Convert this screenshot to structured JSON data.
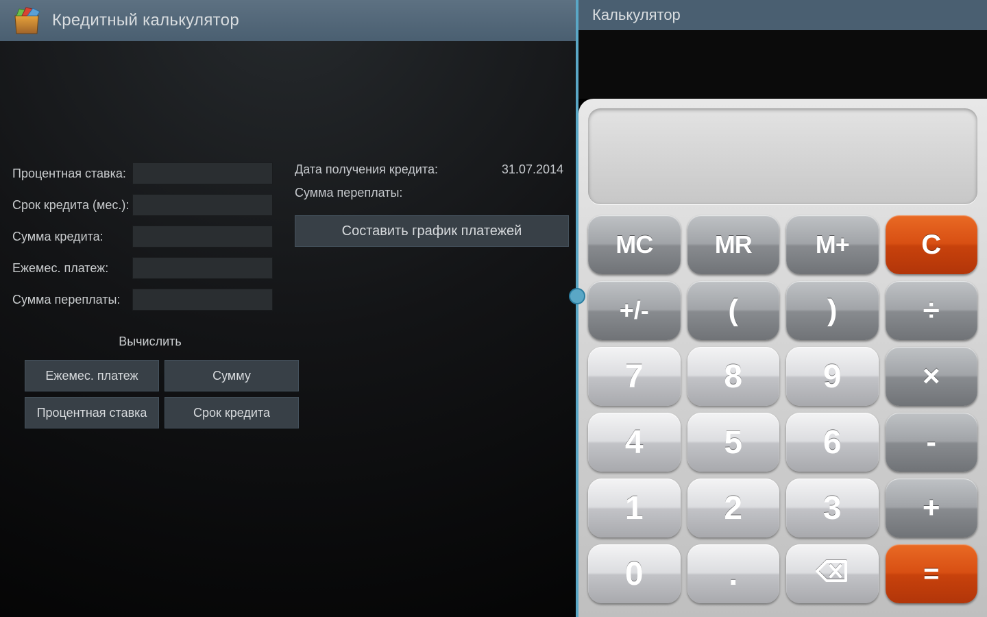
{
  "leftApp": {
    "title": "Кредитный калькулятор",
    "fields": {
      "interestRate": {
        "label": "Процентная ставка:",
        "value": ""
      },
      "termMonths": {
        "label": "Срок кредита (мес.):",
        "value": ""
      },
      "loanAmount": {
        "label": "Сумма кредита:",
        "value": ""
      },
      "monthlyPayment": {
        "label": "Ежемес. платеж:",
        "value": ""
      },
      "overpayment": {
        "label": "Сумма переплаты:",
        "value": ""
      }
    },
    "info": {
      "dateLabel": "Дата получения кредита:",
      "dateValue": "31.07.2014",
      "overpayLabel": "Сумма переплаты:",
      "overpayValue": ""
    },
    "scheduleButton": "Составить график платежей",
    "calcLabel": "Вычислить",
    "buttons": {
      "monthly": "Ежемес. платеж",
      "amount": "Сумму",
      "rate": "Процентная ставка",
      "term": "Срок кредита"
    }
  },
  "rightApp": {
    "title": "Калькулятор",
    "display": "",
    "keys": {
      "mc": "MC",
      "mr": "MR",
      "mplus": "M+",
      "clear": "C",
      "sign": "+/-",
      "lparen": "(",
      "rparen": ")",
      "divide": "÷",
      "k7": "7",
      "k8": "8",
      "k9": "9",
      "multiply": "×",
      "k4": "4",
      "k5": "5",
      "k6": "6",
      "minus": "-",
      "k1": "1",
      "k2": "2",
      "k3": "3",
      "plus": "+",
      "k0": "0",
      "dot": ".",
      "equals": "="
    }
  }
}
